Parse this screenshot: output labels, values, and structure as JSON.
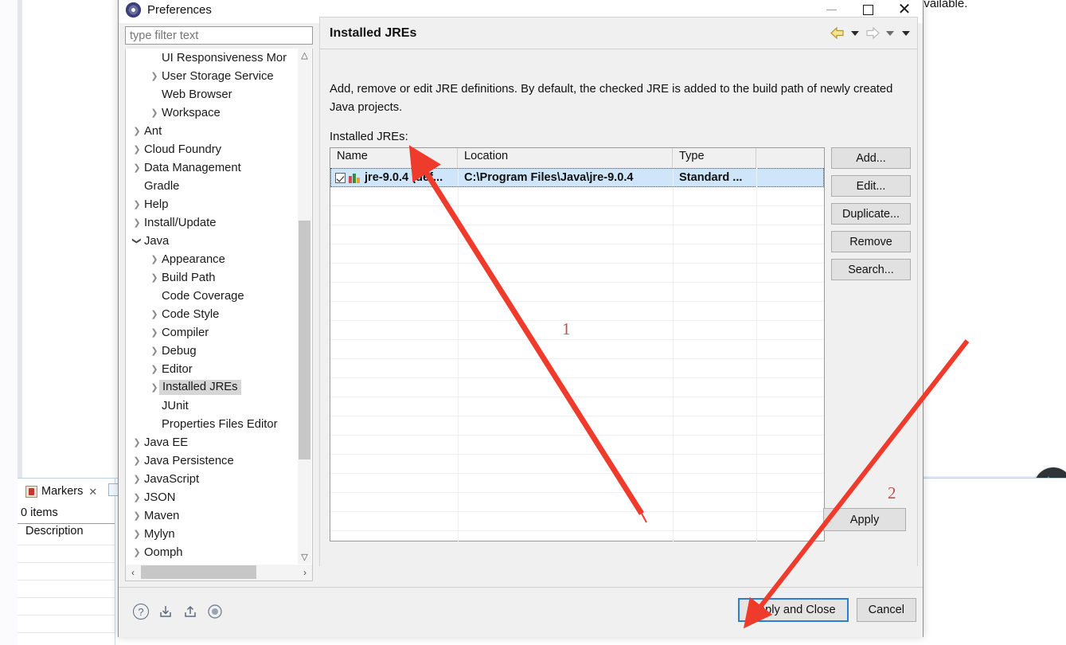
{
  "background": {
    "editor_text_fragment": "available.",
    "markers": {
      "tab_label": "Markers",
      "close_glyph": "✕",
      "items_count": "0 items",
      "column_header": "Description"
    },
    "round_widget": {
      "up_icon": "arrow-up-icon",
      "down_icon": "arrow-down-icon"
    }
  },
  "dialog": {
    "title": "Preferences",
    "title_icon": "preferences-icon",
    "window_controls": {
      "minimize": "minimize-icon",
      "maximize": "maximize-icon",
      "close": "close-icon"
    },
    "filter": {
      "placeholder": "type filter text",
      "value": ""
    },
    "tree": [
      {
        "label": "UI Responsiveness Mor",
        "indent": 2,
        "arrow": ""
      },
      {
        "label": "User Storage Service",
        "indent": 2,
        "arrow": "collapsed"
      },
      {
        "label": "Web Browser",
        "indent": 2,
        "arrow": ""
      },
      {
        "label": "Workspace",
        "indent": 2,
        "arrow": "collapsed"
      },
      {
        "label": "Ant",
        "indent": 1,
        "arrow": "collapsed"
      },
      {
        "label": "Cloud Foundry",
        "indent": 1,
        "arrow": "collapsed"
      },
      {
        "label": "Data Management",
        "indent": 1,
        "arrow": "collapsed"
      },
      {
        "label": "Gradle",
        "indent": 1,
        "arrow": ""
      },
      {
        "label": "Help",
        "indent": 1,
        "arrow": "collapsed"
      },
      {
        "label": "Install/Update",
        "indent": 1,
        "arrow": "collapsed"
      },
      {
        "label": "Java",
        "indent": 1,
        "arrow": "expanded"
      },
      {
        "label": "Appearance",
        "indent": 2,
        "arrow": "collapsed"
      },
      {
        "label": "Build Path",
        "indent": 2,
        "arrow": "collapsed"
      },
      {
        "label": "Code Coverage",
        "indent": 2,
        "arrow": ""
      },
      {
        "label": "Code Style",
        "indent": 2,
        "arrow": "collapsed"
      },
      {
        "label": "Compiler",
        "indent": 2,
        "arrow": "collapsed"
      },
      {
        "label": "Debug",
        "indent": 2,
        "arrow": "collapsed"
      },
      {
        "label": "Editor",
        "indent": 2,
        "arrow": "collapsed"
      },
      {
        "label": "Installed JREs",
        "indent": 2,
        "arrow": "collapsed",
        "selected": true
      },
      {
        "label": "JUnit",
        "indent": 2,
        "arrow": ""
      },
      {
        "label": "Properties Files Editor",
        "indent": 2,
        "arrow": ""
      },
      {
        "label": "Java EE",
        "indent": 1,
        "arrow": "collapsed"
      },
      {
        "label": "Java Persistence",
        "indent": 1,
        "arrow": "collapsed"
      },
      {
        "label": "JavaScript",
        "indent": 1,
        "arrow": "collapsed"
      },
      {
        "label": "JSON",
        "indent": 1,
        "arrow": "collapsed"
      },
      {
        "label": "Maven",
        "indent": 1,
        "arrow": "collapsed"
      },
      {
        "label": "Mylyn",
        "indent": 1,
        "arrow": "collapsed"
      },
      {
        "label": "Oomph",
        "indent": 1,
        "arrow": "collapsed"
      }
    ],
    "page": {
      "title": "Installed JREs",
      "nav": {
        "back": "back-arrow-icon",
        "back_menu": "chevron-down-icon",
        "forward": "forward-arrow-icon",
        "forward_menu": "chevron-down-icon",
        "view_menu": "chevron-down-icon"
      },
      "description": "Add, remove or edit JRE definitions. By default, the checked JRE is added to the build path of newly created Java projects.",
      "list_label": "Installed JREs:",
      "table": {
        "columns": [
          "Name",
          "Location",
          "Type",
          ""
        ],
        "rows": [
          {
            "checked": true,
            "name": "jre-9.0.4 (def...",
            "location": "C:\\Program Files\\Java\\jre-9.0.4",
            "type": "Standard ...",
            "selected": true
          }
        ]
      },
      "side_buttons": [
        "Add...",
        "Edit...",
        "Duplicate...",
        "Remove",
        "Search..."
      ],
      "apply_button": "Apply"
    },
    "footer": {
      "icons": [
        "help-icon",
        "import-icon",
        "export-icon",
        "record-icon"
      ],
      "buttons": [
        {
          "label": "Apply and Close",
          "primary": true
        },
        {
          "label": "Cancel",
          "primary": false
        }
      ]
    }
  },
  "annotations": [
    {
      "number": "1",
      "color": "#c0504d"
    },
    {
      "number": "2",
      "color": "#c0504d"
    }
  ]
}
